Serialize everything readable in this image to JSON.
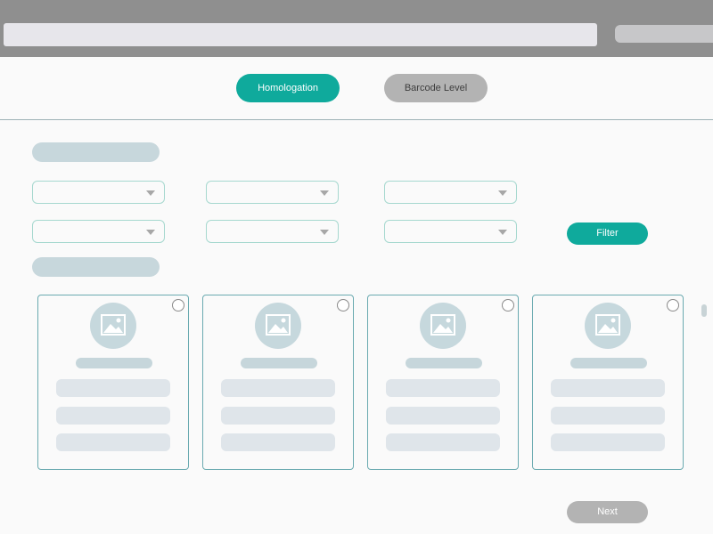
{
  "tabs": {
    "homologation_label": "Homologation",
    "barcode_label": "Barcode Level"
  },
  "filters": {
    "filter_label": "Filter"
  },
  "cards": [
    {
      "id": "card-1"
    },
    {
      "id": "card-2"
    },
    {
      "id": "card-3"
    },
    {
      "id": "card-4"
    }
  ],
  "footer": {
    "next_label": "Next"
  },
  "colors": {
    "accent": "#0faa9c",
    "inactive": "#b3b3b3",
    "card_border": "#6aaab0"
  }
}
